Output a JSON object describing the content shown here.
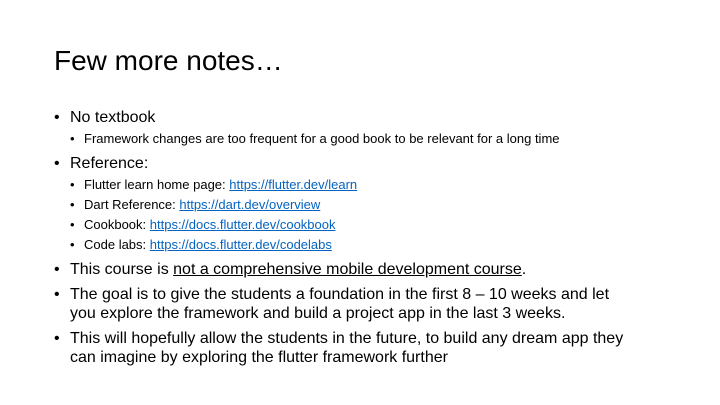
{
  "slide": {
    "title": "Few more notes…",
    "bullets": [
      {
        "text": "No textbook",
        "sub": [
          {
            "text": "Framework changes are too frequent for a good book to be relevant for a long time"
          }
        ]
      },
      {
        "text": "Reference:",
        "sub": [
          {
            "label": "Flutter learn home page: ",
            "link": "https://flutter.dev/learn"
          },
          {
            "label": "Dart Reference: ",
            "link": "https://dart.dev/overview"
          },
          {
            "label": "Cookbook: ",
            "link": "https://docs.flutter.dev/cookbook"
          },
          {
            "label": "Code labs: ",
            "link": "https://docs.flutter.dev/codelabs"
          }
        ]
      },
      {
        "prefix": "This course is ",
        "underlined": "not a comprehensive mobile development course",
        "suffix": "."
      },
      {
        "line1": "The goal is to give the students a foundation in the first 8 – 10 weeks and let",
        "line2": "you explore the framework and build a project app in the last 3 weeks."
      },
      {
        "line1": "This will hopefully allow the students in the future, to build any dream app they",
        "line2": "can imagine by exploring the flutter framework further"
      }
    ]
  }
}
